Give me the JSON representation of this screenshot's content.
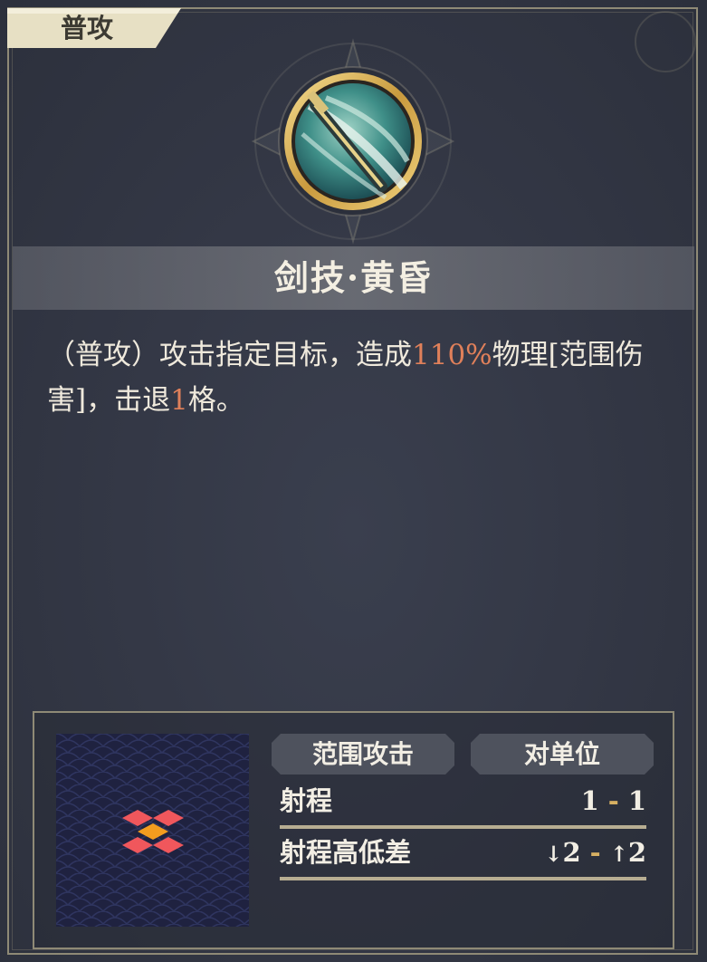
{
  "tab": {
    "label": "普攻"
  },
  "skill": {
    "name": "剑技·黄昏",
    "icon": "sword-slash-icon",
    "description": {
      "p1": "（普攻）攻击指定目标，造成",
      "damage": "110%",
      "p2": "物理[范围伤害]，击退",
      "knockback": "1",
      "p3": "格。"
    }
  },
  "tags": {
    "area": "范围攻击",
    "target": "对单位"
  },
  "stats": {
    "range_label": "射程",
    "range_min": "1",
    "range_sep": "-",
    "range_max": "1",
    "height_label": "射程高低差",
    "height_down_arrow": "↓",
    "height_down": "2",
    "height_sep": "-",
    "height_up_arrow": "↑",
    "height_up": "2"
  },
  "colors": {
    "highlight": "#e0805a",
    "range_cell": "#f0575c",
    "origin_cell": "#f39c1f",
    "frame": "#8f8a76",
    "tab": "#e7e0c4"
  }
}
